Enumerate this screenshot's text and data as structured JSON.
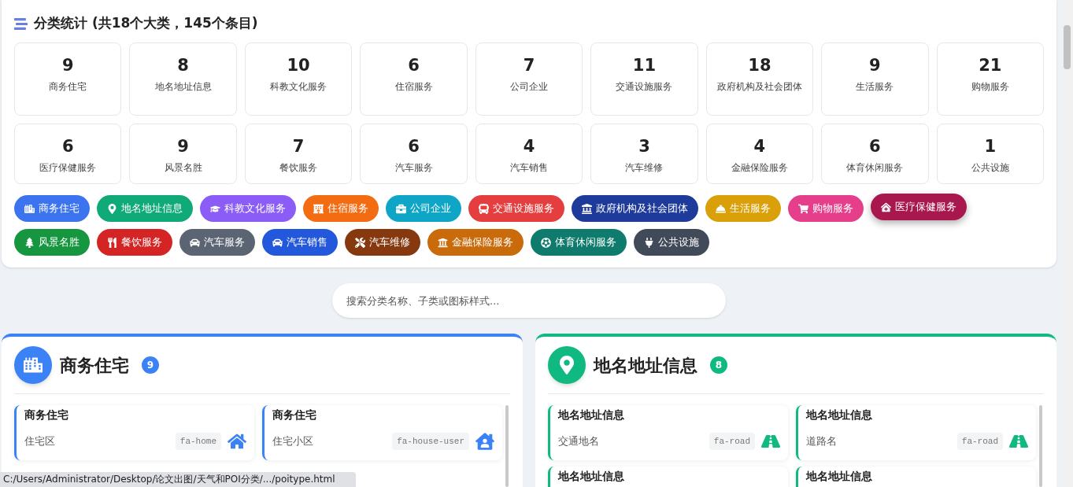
{
  "summary": {
    "title": "分类统计 (共18个大类，145个条目)"
  },
  "stats": [
    {
      "count": "9",
      "label": "商务住宅"
    },
    {
      "count": "8",
      "label": "地名地址信息"
    },
    {
      "count": "10",
      "label": "科教文化服务"
    },
    {
      "count": "6",
      "label": "住宿服务"
    },
    {
      "count": "7",
      "label": "公司企业"
    },
    {
      "count": "11",
      "label": "交通设施服务"
    },
    {
      "count": "18",
      "label": "政府机构及社会团体"
    },
    {
      "count": "9",
      "label": "生活服务"
    },
    {
      "count": "21",
      "label": "购物服务"
    },
    {
      "count": "6",
      "label": "医疗保健服务"
    },
    {
      "count": "9",
      "label": "风景名胜"
    },
    {
      "count": "7",
      "label": "餐饮服务"
    },
    {
      "count": "6",
      "label": "汽车服务"
    },
    {
      "count": "4",
      "label": "汽车销售"
    },
    {
      "count": "3",
      "label": "汽车维修"
    },
    {
      "count": "4",
      "label": "金融保险服务"
    },
    {
      "count": "6",
      "label": "体育休闲服务"
    },
    {
      "count": "1",
      "label": "公共设施"
    }
  ],
  "chips": [
    {
      "label": "商务住宅",
      "color": "#3b74ee",
      "selected": false
    },
    {
      "label": "地名地址信息",
      "color": "#10a978",
      "selected": false
    },
    {
      "label": "科教文化服务",
      "color": "#8b5cf6",
      "selected": false
    },
    {
      "label": "住宿服务",
      "color": "#f46c12",
      "selected": false
    },
    {
      "label": "公司企业",
      "color": "#0ea5c6",
      "selected": false
    },
    {
      "label": "交通设施服务",
      "color": "#e53e3e",
      "selected": false
    },
    {
      "label": "政府机构及社会团体",
      "color": "#1e3a9a",
      "selected": false
    },
    {
      "label": "生活服务",
      "color": "#d9a00a",
      "selected": false
    },
    {
      "label": "购物服务",
      "color": "#e53e8a",
      "selected": false
    },
    {
      "label": "医疗保健服务",
      "color": "#a8184e",
      "selected": true
    },
    {
      "label": "风景名胜",
      "color": "#16963f",
      "selected": false
    },
    {
      "label": "餐饮服务",
      "color": "#d42424",
      "selected": false
    },
    {
      "label": "汽车服务",
      "color": "#5b6472",
      "selected": false
    },
    {
      "label": "汽车销售",
      "color": "#2357dc",
      "selected": false
    },
    {
      "label": "汽车维修",
      "color": "#86380f",
      "selected": false
    },
    {
      "label": "金融保险服务",
      "color": "#c96a0b",
      "selected": false
    },
    {
      "label": "体育休闲服务",
      "color": "#0f7b6c",
      "selected": false
    },
    {
      "label": "公共设施",
      "color": "#414a58",
      "selected": false
    }
  ],
  "search": {
    "placeholder": "搜索分类名称、子类或图标样式..."
  },
  "sections": [
    {
      "title": "商务住宅",
      "count": "9",
      "color": "#3b82f6",
      "items": [
        {
          "title": "商务住宅",
          "name": "住宅区",
          "code": "fa-home"
        },
        {
          "title": "商务住宅",
          "name": "住宅小区",
          "code": "fa-house-user"
        }
      ]
    },
    {
      "title": "地名地址信息",
      "count": "8",
      "color": "#10b981",
      "items": [
        {
          "title": "地名地址信息",
          "name": "交通地名",
          "code": "fa-road"
        },
        {
          "title": "地名地址信息",
          "name": "道路名",
          "code": "fa-road"
        },
        {
          "title": "地名地址信息"
        },
        {
          "title": "地名地址信息"
        }
      ]
    }
  ],
  "status_bar": "C:/Users/Administrator/Desktop/论文出图/天气和POI分类/.../poitype.html"
}
